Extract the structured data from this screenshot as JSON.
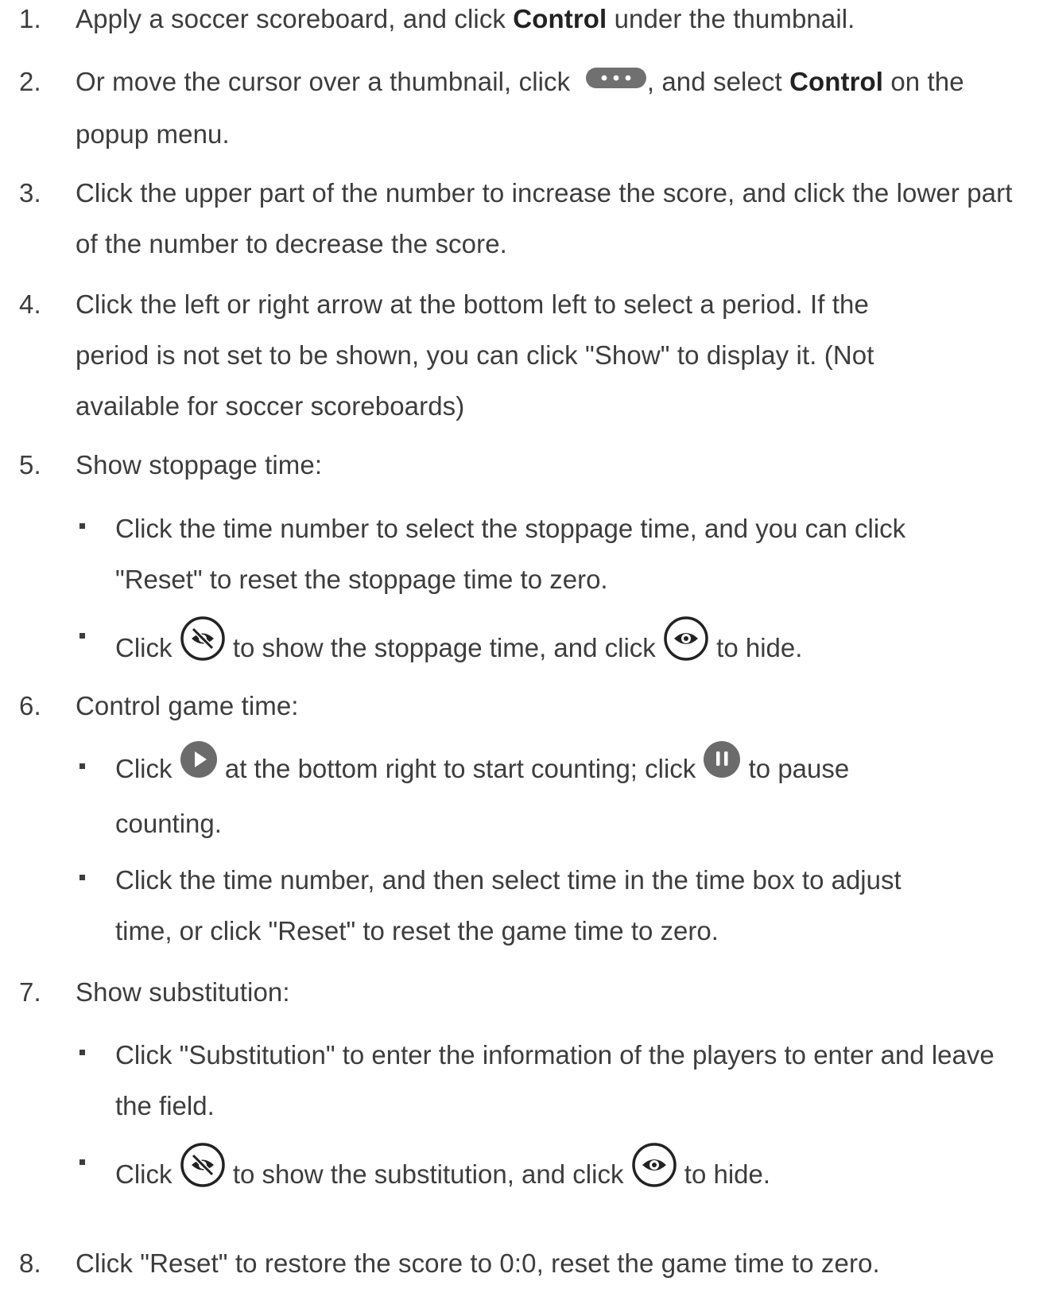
{
  "steps": [
    {
      "num": "1.",
      "t1": "Apply a soccer scoreboard, and click ",
      "b1": "Control",
      "t2": " under the thumbnail."
    },
    {
      "num": "2.",
      "t1": "Or move the cursor over a thumbnail, click ",
      "t2": ", and select ",
      "b1": "Control",
      "t3": " on the popup menu."
    },
    {
      "num": "3.",
      "text": "Click the upper part of the number to increase the score, and click the lower part of the number to decrease the score."
    },
    {
      "num": "4.",
      "text": "Click the left or right arrow at the bottom left to select a period. If the period is not set to be shown, you can click \"Show\" to display it. (Not available for soccer scoreboards)"
    },
    {
      "num": "5.",
      "text": "Show stoppage time:"
    },
    {
      "num": "6.",
      "text": "Control game time:"
    },
    {
      "num": "7.",
      "text": "Show substitution:"
    },
    {
      "num": "8.",
      "text": "Click \"Reset\" to restore the score to 0:0, reset the game time to zero."
    }
  ],
  "subs": {
    "s5a": {
      "text": "Click the time number to select the stoppage time, and you can click \"Reset\" to reset the stoppage time to zero."
    },
    "s5b": {
      "t1": "Click ",
      "t2": " to show the stoppage time, and click ",
      "t3": " to hide."
    },
    "s6a": {
      "t1": "Click ",
      "t2": " at the bottom right to start counting; click ",
      "t3": " to pause counting."
    },
    "s6b": {
      "text": "Click the time number, and then select time in the time box to adjust time, or click \"Reset\" to reset the game time to zero."
    },
    "s7a": {
      "text": "Click \"Substitution\" to enter the information of the players to enter and leave the field."
    },
    "s7b": {
      "t1": "Click ",
      "t2": " to show the substitution, and click ",
      "t3": " to hide."
    }
  }
}
